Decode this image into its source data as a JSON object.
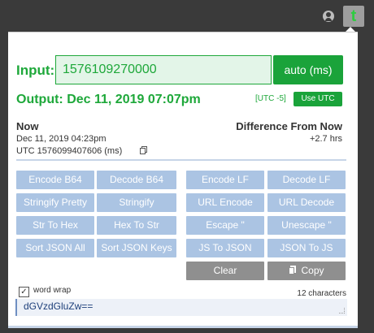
{
  "browser": {
    "profile_icon": "user-circle-icon",
    "extension_icon": "t-extension-icon",
    "extension_letter": "t"
  },
  "input": {
    "label": "Input:",
    "value": "1576109270000",
    "mode_button": "auto (ms)"
  },
  "output": {
    "text": "Output: Dec 11, 2019 07:07pm",
    "utc_offset": "[UTC -5]",
    "use_utc_button": "Use UTC"
  },
  "now": {
    "title": "Now",
    "date": "Dec 11, 2019 04:23pm",
    "utc": "UTC 1576099407606 (ms)",
    "copy_icon": "copy-icon"
  },
  "difference": {
    "title": "Difference From Now",
    "value": "+2.7 hrs"
  },
  "buttons": {
    "encode_b64": "Encode B64",
    "decode_b64": "Decode B64",
    "encode_lf": "Encode LF",
    "decode_lf": "Decode LF",
    "stringify_pretty": "Stringify Pretty",
    "stringify": "Stringify",
    "url_encode": "URL Encode",
    "url_decode": "URL Decode",
    "str_to_hex": "Str To Hex",
    "hex_to_str": "Hex To Str",
    "escape_quote": "Escape \"",
    "unescape_quote": "Unescape \"",
    "sort_json_all": "Sort JSON All",
    "sort_json_keys": "Sort JSON Keys",
    "js_to_json": "JS To JSON",
    "json_to_js": "JSON To JS",
    "clear": "Clear",
    "copy": "Copy"
  },
  "footer": {
    "word_wrap_label": "word wrap",
    "word_wrap_checked": true,
    "char_count": "12 characters",
    "result": "dGVzdGluZw=="
  },
  "colors": {
    "accent_green": "#1aa33a",
    "button_blue": "#abc4e3",
    "button_gray": "#8f8f8f"
  }
}
